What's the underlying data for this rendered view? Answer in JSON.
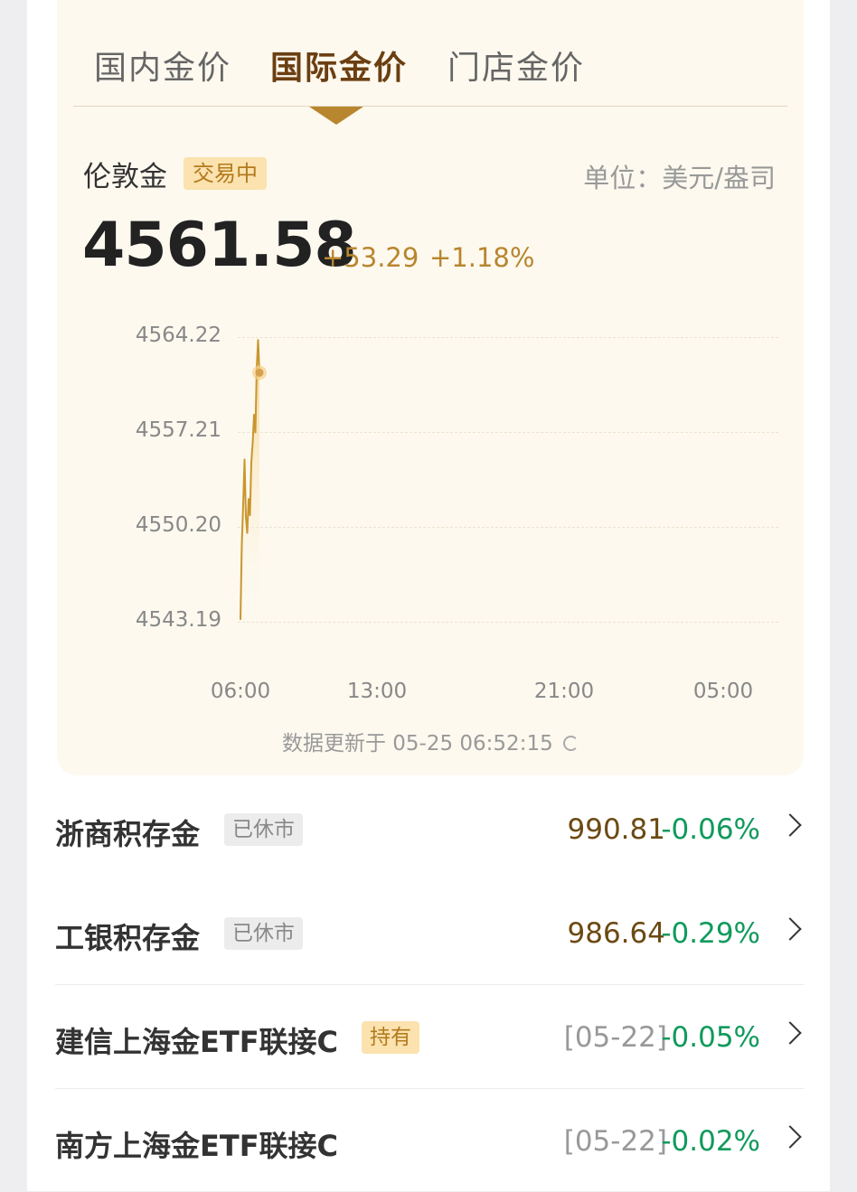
{
  "tabs": [
    {
      "label": "国内金价",
      "active": false
    },
    {
      "label": "国际金价",
      "active": true
    },
    {
      "label": "门店金价",
      "active": false
    }
  ],
  "quote": {
    "name": "伦敦金",
    "status": "交易中",
    "unit": "单位：美元/盎司",
    "price": "4561.58",
    "change": "+53.29",
    "change_pct": "+1.18%"
  },
  "chart_data": {
    "type": "line",
    "y_ticks": [
      "4564.22",
      "4557.21",
      "4550.20",
      "4543.19"
    ],
    "x_ticks": [
      "06:00",
      "13:00",
      "21:00",
      "05:00"
    ],
    "ylim": [
      4543.19,
      4564.22
    ],
    "series": [
      {
        "values": [
          4543.4,
          4549.0,
          4551.9,
          4555.2,
          4551.0,
          4549.8,
          4552.3,
          4551.1,
          4555.0,
          4556.4,
          4558.5,
          4557.2,
          4562.0,
          4564.0,
          4561.6
        ]
      }
    ],
    "colors": {
      "line": "#c9962e",
      "fill": "#f7d28b",
      "marker": "#d4a24c"
    }
  },
  "update_text": "数据更新于 05-25 06:52:15",
  "refresh_icon": "refresh-icon",
  "funds": [
    {
      "name": "浙商积存金",
      "tag": "已休市",
      "tag_type": "closed",
      "value": "990.81",
      "value_style": "gold",
      "pct": "-0.06%"
    },
    {
      "name": "工银积存金",
      "tag": "已休市",
      "tag_type": "closed",
      "value": "986.64",
      "value_style": "gold",
      "pct": "-0.29%"
    },
    {
      "name": "建信上海金ETF联接C",
      "tag": "持有",
      "tag_type": "hold",
      "value": "[05-22]",
      "value_style": "gray",
      "pct": "-0.05%"
    },
    {
      "name": "南方上海金ETF联接C",
      "tag": "",
      "tag_type": "",
      "value": "[05-22]",
      "value_style": "gray",
      "pct": "-0.02%"
    }
  ]
}
